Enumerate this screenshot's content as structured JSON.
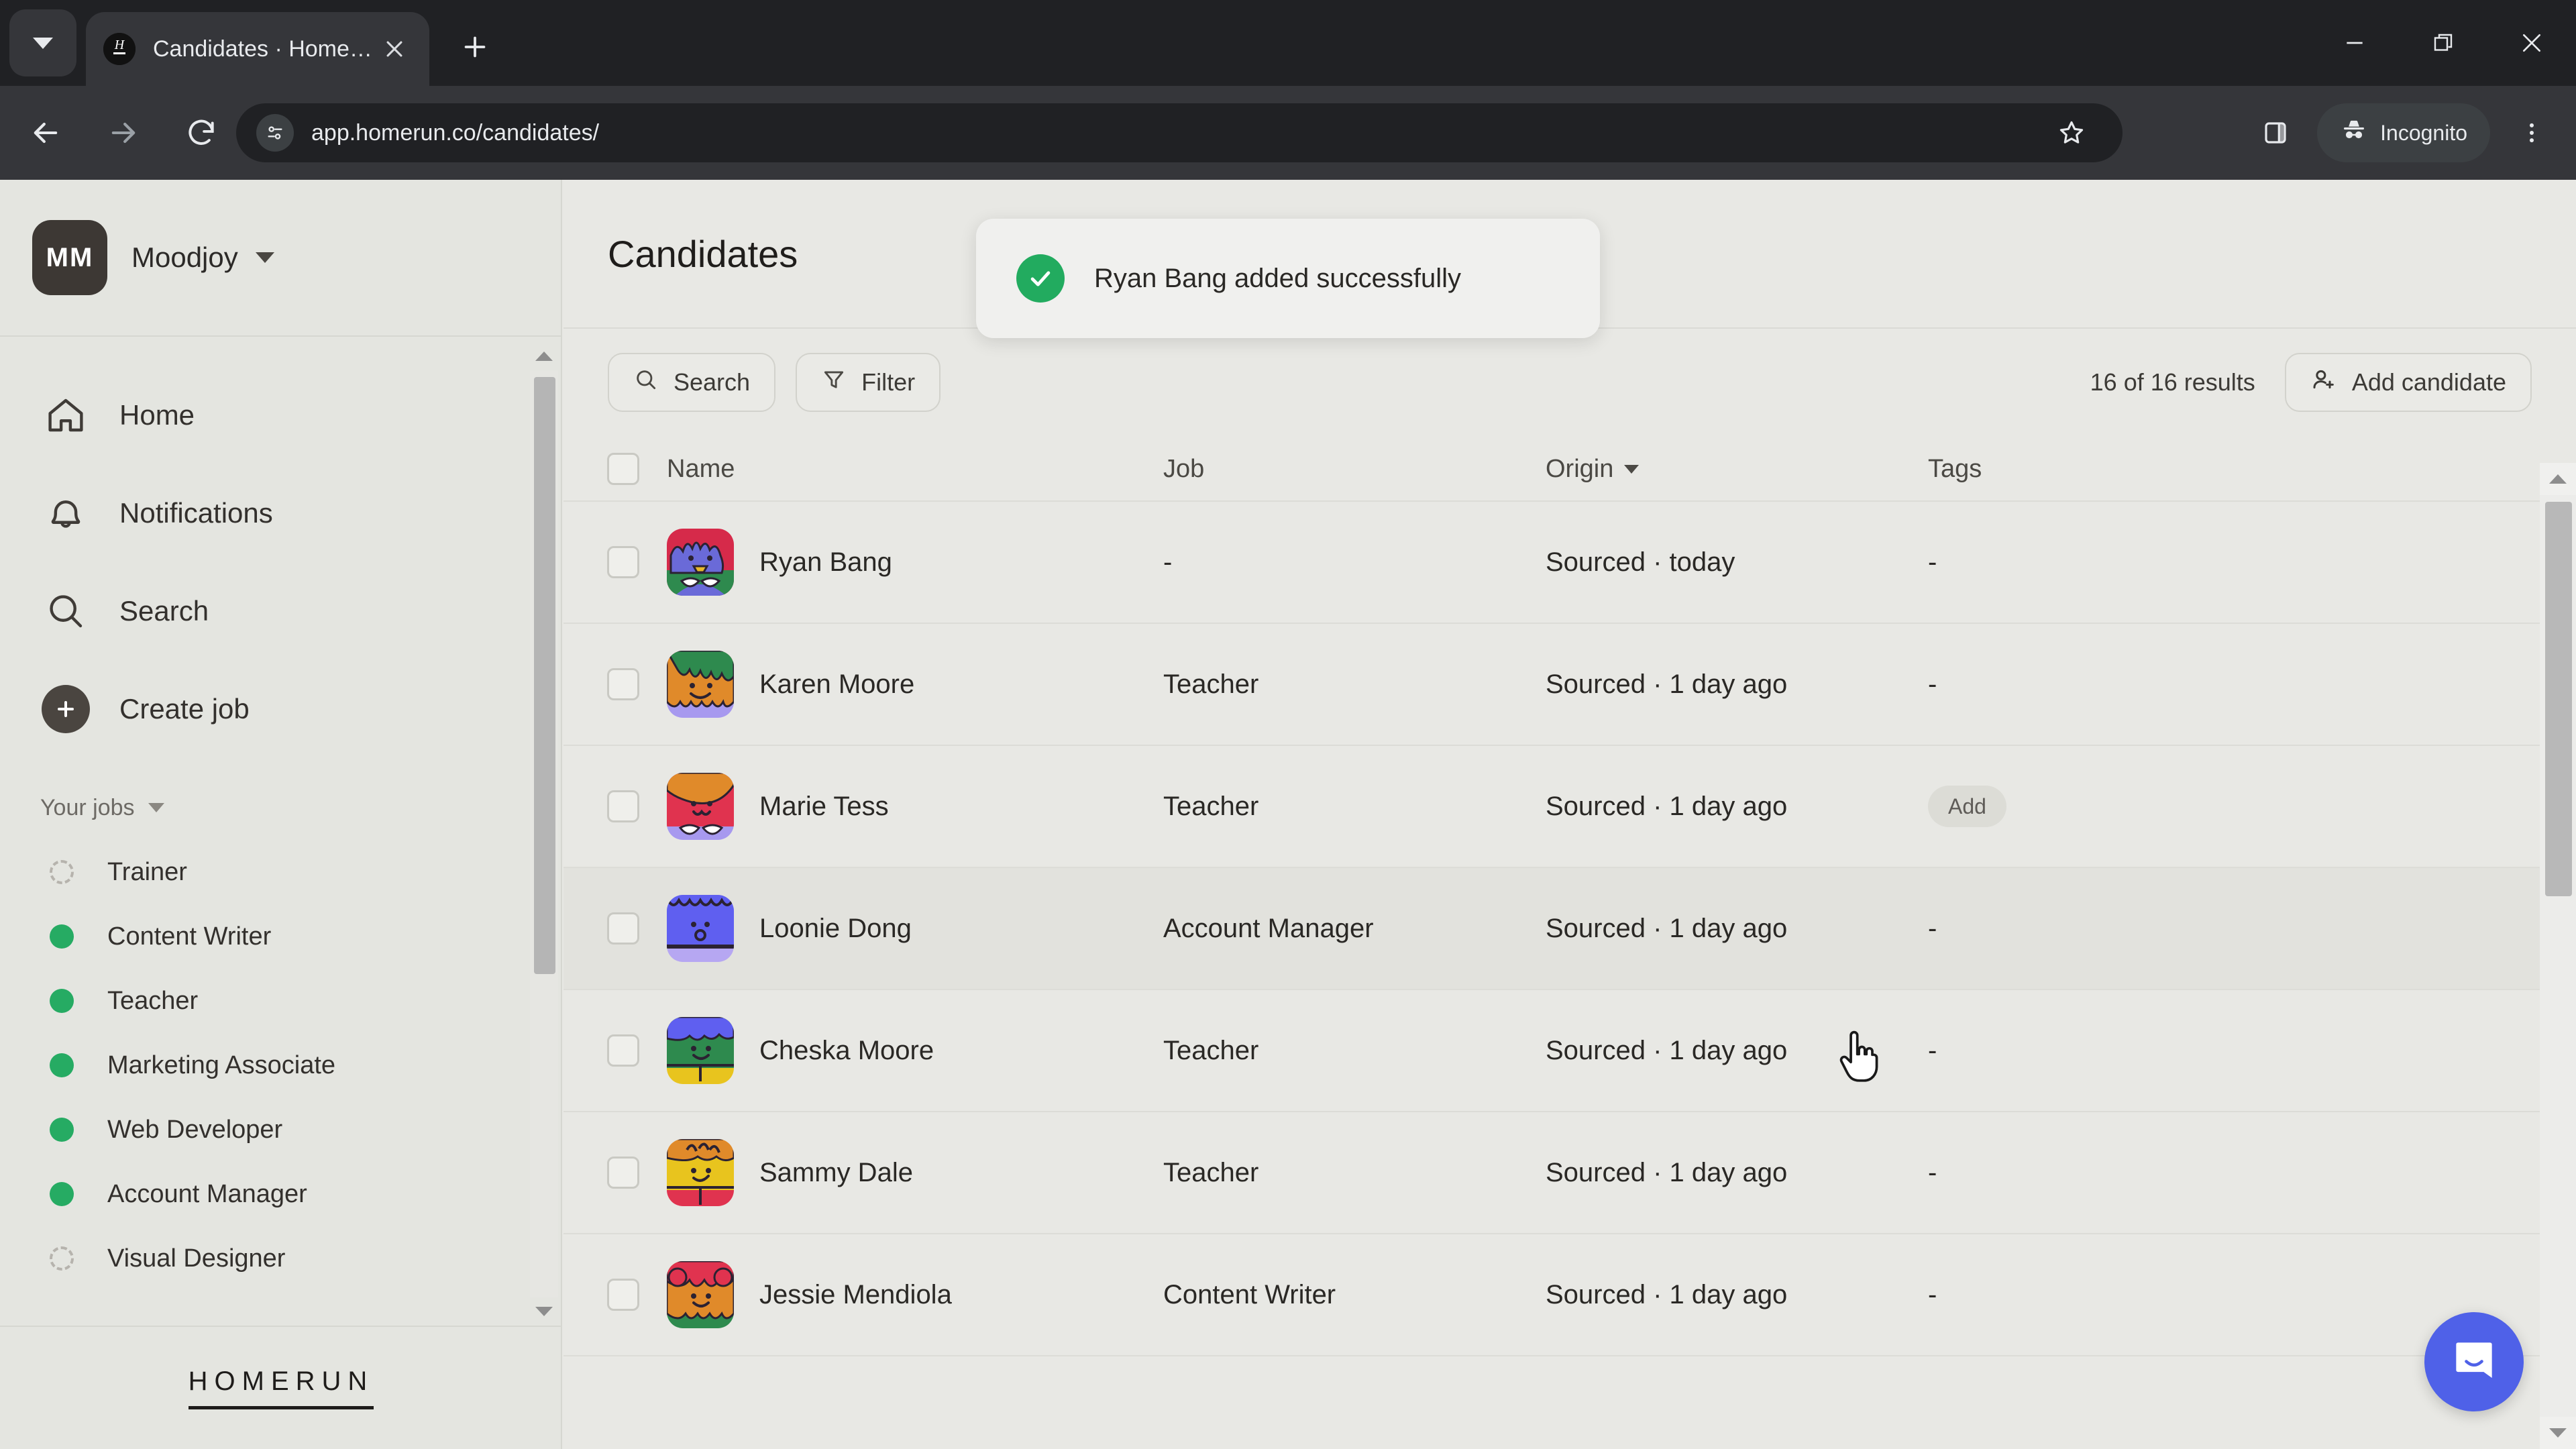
{
  "browser": {
    "tab": {
      "title": "Candidates · Homerun",
      "favicon_icon": "homerun-favicon",
      "close_icon": "close-icon"
    },
    "tab_search_icon": "chevron-down-icon",
    "new_tab_icon": "plus-icon",
    "window_controls": {
      "minimize": "minimize-icon",
      "maximize": "restore-icon",
      "close": "close-icon"
    },
    "nav": {
      "back_icon": "arrow-back-icon",
      "forward_icon": "arrow-forward-icon",
      "reload_icon": "reload-icon"
    },
    "omnibox": {
      "url": "app.homerun.co/candidates/",
      "site_info_icon": "page-settings-icon",
      "bookmark_icon": "star-icon"
    },
    "side_panel_icon": "side-panel-icon",
    "incognito_label": "Incognito",
    "incognito_icon": "incognito-icon",
    "menu_icon": "three-dot-menu-icon"
  },
  "sidebar": {
    "org": {
      "initials": "MM",
      "name": "Moodjoy",
      "caret_icon": "chevron-down-icon"
    },
    "nav_items": [
      {
        "label": "Home",
        "icon": "home-icon"
      },
      {
        "label": "Notifications",
        "icon": "bell-icon"
      },
      {
        "label": "Search",
        "icon": "search-icon"
      },
      {
        "label": "Create job",
        "icon": "plus-circle-icon"
      }
    ],
    "jobs_section": {
      "label": "Your jobs",
      "caret_icon": "chevron-down-icon"
    },
    "jobs": [
      {
        "label": "Trainer",
        "status": "draft"
      },
      {
        "label": "Content Writer",
        "status": "live"
      },
      {
        "label": "Teacher",
        "status": "live"
      },
      {
        "label": "Marketing Associate",
        "status": "live"
      },
      {
        "label": "Web Developer",
        "status": "live"
      },
      {
        "label": "Account Manager",
        "status": "live"
      },
      {
        "label": "Visual Designer",
        "status": "draft"
      }
    ],
    "footer_logo": "HOMERUN"
  },
  "main": {
    "page_title": "Candidates",
    "toolbar": {
      "search_label": "Search",
      "search_icon": "search-icon",
      "filter_label": "Filter",
      "filter_icon": "funnel-icon",
      "results_text": "16 of 16 results",
      "add_candidate_label": "Add candidate",
      "add_candidate_icon": "user-plus-icon"
    },
    "table": {
      "columns": [
        "Name",
        "Job",
        "Origin",
        "Tags"
      ],
      "sorted_column": "Origin",
      "sort_caret_icon": "caret-down-icon",
      "rows": [
        {
          "name": "Ryan Bang",
          "job": "-",
          "origin": "Sourced · today",
          "tags": "-",
          "tag_is_button": false,
          "hovered": false,
          "avatar": "a1"
        },
        {
          "name": "Karen Moore",
          "job": "Teacher",
          "origin": "Sourced · 1 day ago",
          "tags": "-",
          "tag_is_button": false,
          "hovered": false,
          "avatar": "a2"
        },
        {
          "name": "Marie Tess",
          "job": "Teacher",
          "origin": "Sourced · 1 day ago",
          "tags": "Add",
          "tag_is_button": true,
          "hovered": false,
          "avatar": "a3"
        },
        {
          "name": "Loonie Dong",
          "job": "Account Manager",
          "origin": "Sourced · 1 day ago",
          "tags": "-",
          "tag_is_button": false,
          "hovered": true,
          "avatar": "a4"
        },
        {
          "name": "Cheska Moore",
          "job": "Teacher",
          "origin": "Sourced · 1 day ago",
          "tags": "-",
          "tag_is_button": false,
          "hovered": false,
          "avatar": "a5"
        },
        {
          "name": "Sammy Dale",
          "job": "Teacher",
          "origin": "Sourced · 1 day ago",
          "tags": "-",
          "tag_is_button": false,
          "hovered": false,
          "avatar": "a6"
        },
        {
          "name": "Jessie Mendiola",
          "job": "Content Writer",
          "origin": "Sourced · 1 day ago",
          "tags": "-",
          "tag_is_button": false,
          "hovered": false,
          "avatar": "a7"
        }
      ]
    }
  },
  "toast": {
    "message": "Ryan Bang added successfully",
    "icon": "success-check-icon"
  },
  "intercom": {
    "icon": "chat-bubble-icon"
  },
  "cursor": {
    "icon": "pointer-hand-icon"
  },
  "colors": {
    "brand_green": "#26ab63",
    "toast_green": "#22ab5f",
    "intercom_blue": "#4f61e8",
    "page_bg": "#e8e8e4",
    "sidebar_bg": "#e4e5e0",
    "chrome_dark": "#202124",
    "chrome_toolbar": "#35363a",
    "text_primary": "#2a2825"
  }
}
